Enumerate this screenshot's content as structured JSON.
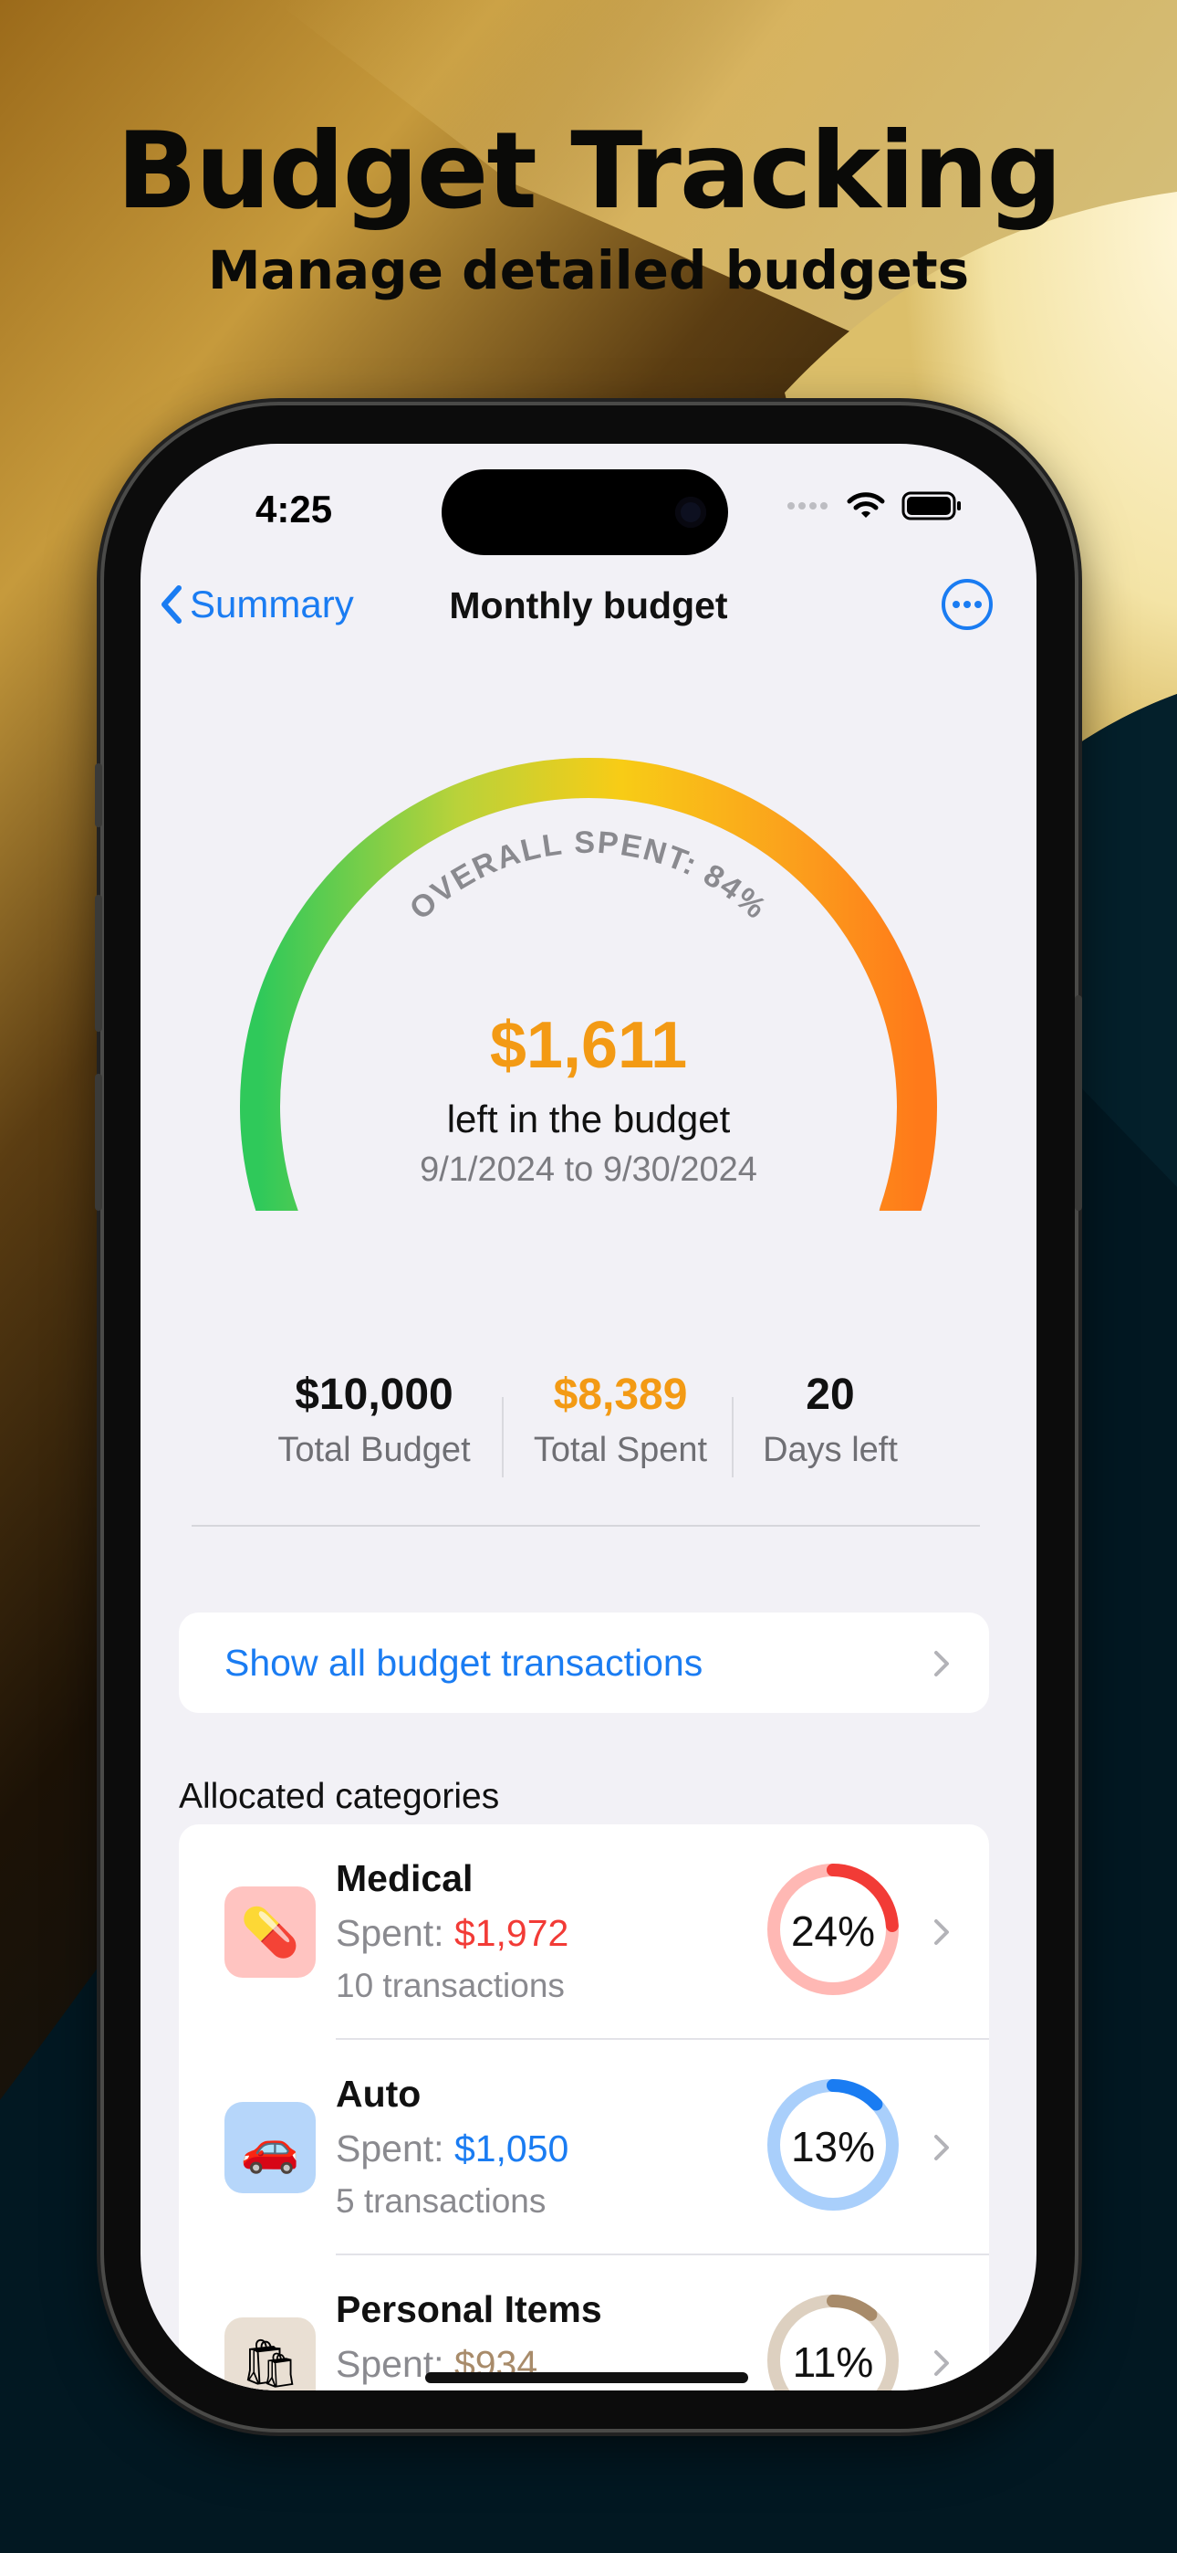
{
  "marketing": {
    "headline": "Budget Tracking",
    "subheadline": "Manage detailed budgets"
  },
  "status_bar": {
    "time": "4:25"
  },
  "nav": {
    "back_label": "Summary",
    "title": "Monthly budget"
  },
  "gauge": {
    "arc_label": "OVERALL SPENT: 84%",
    "spent_fraction": 0.84,
    "amount_left": "$1,611",
    "amount_left_label": "left in the budget",
    "date_range": "9/1/2024 to 9/30/2024"
  },
  "stats": [
    {
      "value": "$10,000",
      "label": "Total Budget",
      "color": "#111111"
    },
    {
      "value": "$8,389",
      "label": "Total Spent",
      "color": "#f39a14"
    },
    {
      "value": "20",
      "label": "Days left",
      "color": "#111111"
    }
  ],
  "show_all_label": "Show all budget transactions",
  "section_title": "Allocated categories",
  "categories": [
    {
      "name": "Medical",
      "spent_prefix": "Spent: ",
      "spent": "$1,972",
      "transactions": "10 transactions",
      "percent": "24%",
      "fraction": 0.24,
      "color": "#f23b36",
      "track": "#ffb8b4",
      "icon": "pill-icon",
      "icon_bg": "#ffc4c1",
      "glyph": "💊"
    },
    {
      "name": "Auto",
      "spent_prefix": "Spent: ",
      "spent": "$1,050",
      "transactions": "5 transactions",
      "percent": "13%",
      "fraction": 0.13,
      "color": "#1a7cf2",
      "track": "#a9cffb",
      "icon": "car-icon",
      "icon_bg": "#b6d6fa",
      "glyph": "🚗"
    },
    {
      "name": "Personal Items",
      "spent_prefix": "Spent: ",
      "spent": "$934",
      "transactions": "",
      "percent": "11%",
      "fraction": 0.11,
      "color": "#a88b6a",
      "track": "#ddd0c0",
      "icon": "shopping-bags-icon",
      "icon_bg": "#e9dfd3",
      "glyph": "🛍"
    }
  ]
}
